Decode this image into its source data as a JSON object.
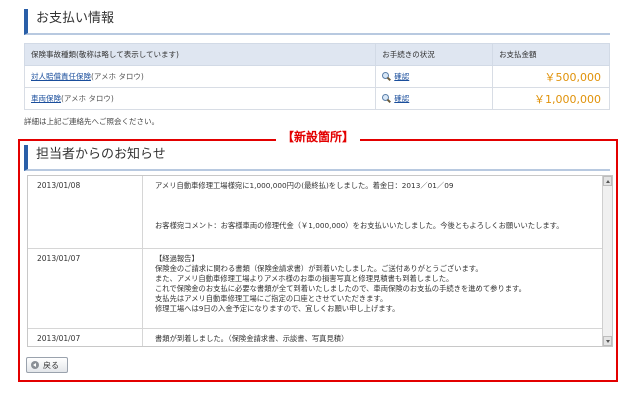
{
  "payment_section": {
    "title": "お支払い情報",
    "table": {
      "headers": [
        "保険事故種類(敬称は略して表示しています)",
        "お手続きの状況",
        "お支払金額"
      ],
      "rows": [
        {
          "type_link": "対人賠償責任保険",
          "person": "(アメホ タロウ)",
          "status": "確認",
          "amount": "￥500,000"
        },
        {
          "type_link": "車両保険",
          "person": "(アメホ タロウ)",
          "status": "確認",
          "amount": "￥1,000,000"
        }
      ]
    },
    "note": "詳細は上記ご連絡先へご照会ください。"
  },
  "new_label": "【新設箇所】",
  "notice_section": {
    "title": "担当者からのお知らせ",
    "entries": [
      {
        "date": "2013/01/08",
        "lines": [
          "アメリ自動車修理工場様宛に1,000,000円の(最終払)をしました。着金日：2013／01／09",
          "",
          "",
          "",
          "お客様宛コメント：お客様車両の修理代金（￥1,000,000）をお支払いいたしました。今後ともよろしくお願いいたします。"
        ]
      },
      {
        "date": "2013/01/07",
        "lines": [
          "【経過報告】",
          "保険金のご請求に関わる書類（保険金請求書）が到着いたしました。ご送付ありがとうございます。",
          "また、アメリ自動車修理工場よりアメホ様のお車の損害写真と修理見積書も到着しました。",
          "これで保険金のお支払に必要な書類が全て到着いたしましたので、車両保険のお支払の手続きを進めて参ります。",
          "支払先はアメリ自動車修理工場にご指定の口座とさせていただきます。",
          "修理工場へは9日の入金予定になりますので、宜しくお願い申し上げます。"
        ]
      },
      {
        "date": "2013/01/07",
        "lines": [
          "書類が到着しました。（保険金請求書、示談書、写真見積）"
        ]
      }
    ]
  },
  "back_button": {
    "label": "戻る"
  },
  "colors": {
    "accent": "#2a5fa8",
    "highlight": "#e30000",
    "amount": "#e0920a"
  }
}
